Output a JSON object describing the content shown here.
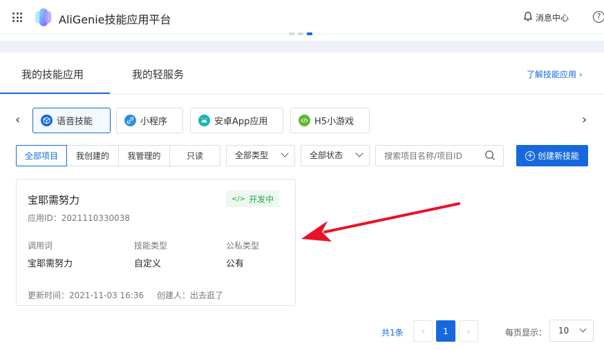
{
  "header": {
    "app_title": "AliGenie技能应用平台",
    "messages_label": "消息中心",
    "help_symbol": "?",
    "icons": [
      "apps-grid-icon",
      "aligenie-logo",
      "bell-icon",
      "help-icon"
    ]
  },
  "tabs": {
    "items": [
      "我的技能应用",
      "我的轻服务"
    ],
    "active_index": 0,
    "learn_more": "了解技能应用",
    "learn_more_chevron": "›"
  },
  "categories": {
    "prev_arrow": "‹",
    "next_arrow": "›",
    "items": [
      {
        "label": "语音技能",
        "icon": "cube-icon",
        "color": "#1668dc",
        "active": true
      },
      {
        "label": "小程序",
        "icon": "link-icon",
        "color": "#2f8ee0",
        "active": false
      },
      {
        "label": "安卓App应用",
        "icon": "android-icon",
        "color": "#18b6b0",
        "active": false
      },
      {
        "label": "H5小游戏",
        "icon": "code-icon",
        "color": "#5cba2f",
        "active": false
      }
    ]
  },
  "filters": {
    "scope": [
      "全部项目",
      "我创建的",
      "我管理的",
      "只读"
    ],
    "scope_active_index": 0,
    "type_select": "全部类型",
    "status_select": "全部状态",
    "search_placeholder": "搜索项目名称/项目ID",
    "create_button": "创建新技能",
    "create_plus": "+"
  },
  "card": {
    "title": "宝耶需努力",
    "status_badge": "开发中",
    "status_icon": "</>",
    "app_id": "应用ID：2021110330038",
    "fields": [
      {
        "label": "调用词",
        "value": "宝耶需努力"
      },
      {
        "label": "技能类型",
        "value": "自定义"
      },
      {
        "label": "公私类型",
        "value": "公有"
      }
    ],
    "updated": "更新时间：2021-11-03 16:36",
    "creator": "创建人：出去逛了"
  },
  "pagination": {
    "total": "共1条",
    "prev": "‹",
    "current_page": "1",
    "next": "›",
    "per_page_label": "每页显示：",
    "per_page_value": "10"
  },
  "colors": {
    "accent": "#1668dc",
    "status_green": "#2ea155",
    "annotation_red": "#e8132a"
  }
}
